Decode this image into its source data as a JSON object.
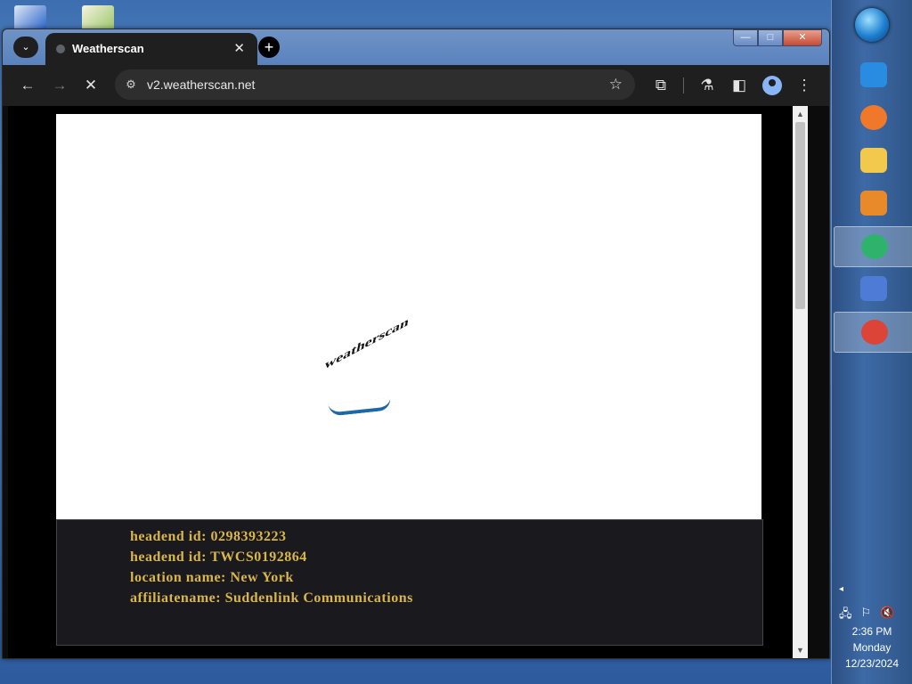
{
  "window": {
    "tab_title": "Weatherscan",
    "tab_close": "✕",
    "new_tab": "+",
    "tab_search": "⌄",
    "min": "—",
    "max": "□",
    "close": "✕"
  },
  "toolbar": {
    "back": "←",
    "forward": "→",
    "stop": "✕",
    "url": "v2.weatherscan.net",
    "site_info": "⚙",
    "bookmark": "☆",
    "extensions": "⧉",
    "labs": "⚗",
    "sidepanel": "◧",
    "menu": "⋮"
  },
  "page": {
    "logo_text": "weatherscan",
    "info_lines": [
      "headend id: 0298393223",
      "headend id: TWCS0192864",
      "location name: New York",
      "affiliatename: Suddenlink Communications"
    ]
  },
  "scrollbar": {
    "up": "▲",
    "down": "▼"
  },
  "taskbar": {
    "apps": [
      {
        "name": "internet-explorer",
        "color": "#2a8ce0"
      },
      {
        "name": "firefox",
        "color": "#f0782a"
      },
      {
        "name": "file-explorer",
        "color": "#f2c94c"
      },
      {
        "name": "media-player",
        "color": "#e88a2a"
      },
      {
        "name": "app-green",
        "color": "#2fb36c"
      },
      {
        "name": "control-panel",
        "color": "#4d7bd6"
      },
      {
        "name": "chrome",
        "color": "#db4437"
      }
    ],
    "tray_arrow": "◂",
    "time": "2:36 PM",
    "day": "Monday",
    "date": "12/23/2024"
  }
}
